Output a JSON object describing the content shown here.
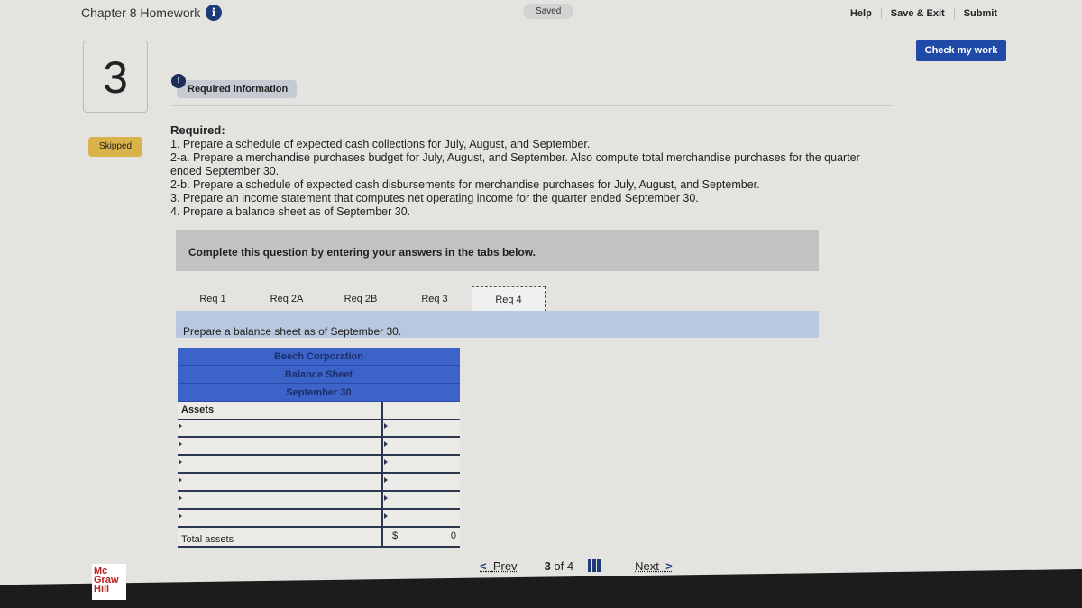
{
  "header": {
    "title": "Chapter 8 Homework",
    "saved": "Saved",
    "links": [
      "Help",
      "Save & Exit",
      "Submit"
    ],
    "check_label": "Check my work"
  },
  "question": {
    "number": "3",
    "status": "Skipped",
    "required_info": "Required information"
  },
  "required": {
    "heading": "Required:",
    "items": [
      "1. Prepare a schedule of expected cash collections for July, August, and September.",
      "2-a. Prepare a merchandise purchases budget for July, August, and September. Also compute total merchandise purchases for the quarter ended September 30.",
      "2-b. Prepare a schedule of expected cash disbursements for merchandise purchases for July, August, and September.",
      "3. Prepare an income statement that computes net operating income for the quarter ended September 30.",
      "4. Prepare a balance sheet as of September 30."
    ]
  },
  "banner": "Complete this question by entering your answers in the tabs below.",
  "tabs": [
    {
      "label": "Req 1"
    },
    {
      "label": "Req 2A"
    },
    {
      "label": "Req 2B"
    },
    {
      "label": "Req 3"
    },
    {
      "label": "Req 4",
      "active": true
    }
  ],
  "prompt": "Prepare a balance sheet as of September 30.",
  "sheet": {
    "company": "Beech Corporation",
    "title": "Balance Sheet",
    "date": "September 30",
    "section": "Assets",
    "rows": 6,
    "total_label": "Total assets",
    "total_currency": "$",
    "total_value": "0"
  },
  "pager": {
    "prev": "Prev",
    "current": "3",
    "of": "of",
    "total": "4",
    "next": "Next"
  },
  "logo": "Mc Graw Hill",
  "colors": {
    "accent": "#1f4aa8",
    "sheet_header": "#3c64c8",
    "skipped": "#d9b24a"
  }
}
